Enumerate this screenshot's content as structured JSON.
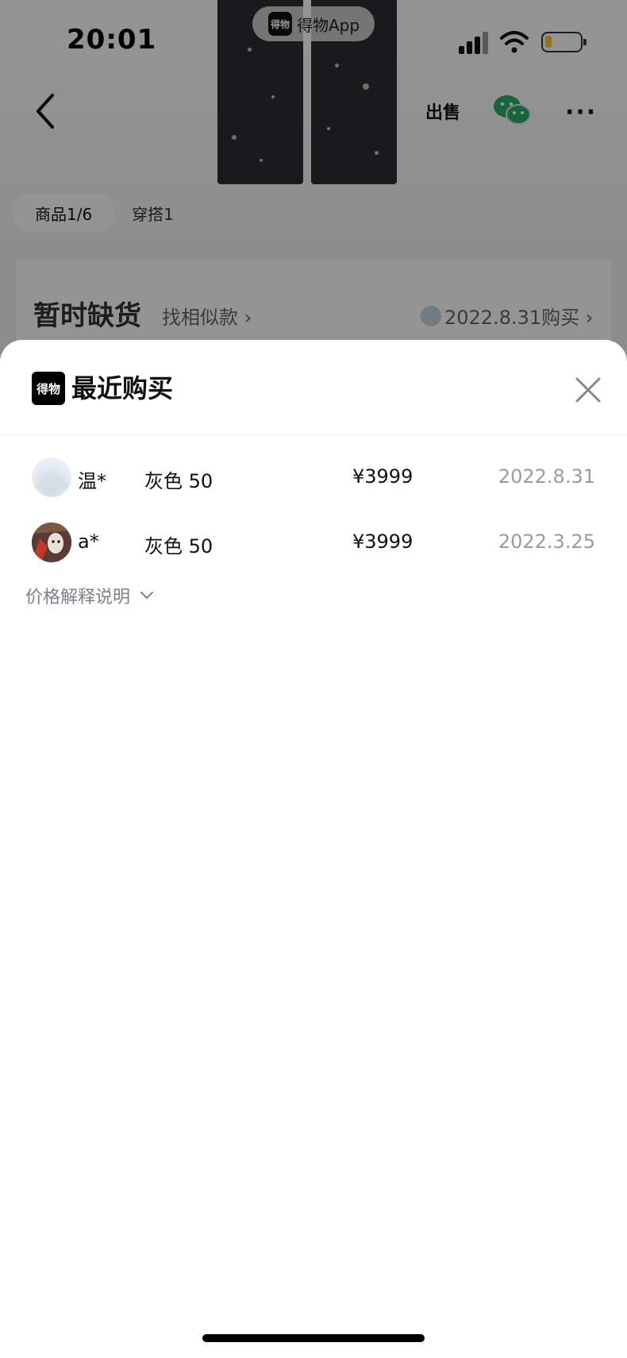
{
  "status_bar": {
    "time": "20:01",
    "app_pill_label": "得物App",
    "app_logo_text": "得物",
    "battery_level": 0.2
  },
  "nav": {
    "sell_label": "出售"
  },
  "gallery": {
    "tabs": [
      {
        "label": "商品1/6"
      },
      {
        "label": "穿搭1"
      }
    ]
  },
  "stock": {
    "status_label": "暂时缺货",
    "similar_label": "找相似款 ›",
    "recent_label": "2022.8.31购买 ›"
  },
  "sheet": {
    "logo_text": "得物",
    "title": "最近购买",
    "purchases": [
      {
        "buyer": "温*",
        "spec": "灰色 50",
        "price": "¥3999",
        "date": "2022.8.31"
      },
      {
        "buyer": "a*",
        "spec": "灰色 50",
        "price": "¥3999",
        "date": "2022.3.25"
      }
    ],
    "price_explain_label": "价格解释说明"
  },
  "colors": {
    "scrim": "#000000",
    "sheet_background": "#ffffff",
    "muted_text": "#9a9aa3",
    "battery_fill": "#f6c623",
    "wechat_green": "#2aae67"
  },
  "icons": {
    "back": "chevron-left-icon",
    "share_wechat": "wechat-icon",
    "more": "more-dots-icon",
    "close": "close-icon",
    "expand": "chevron-down-icon"
  }
}
